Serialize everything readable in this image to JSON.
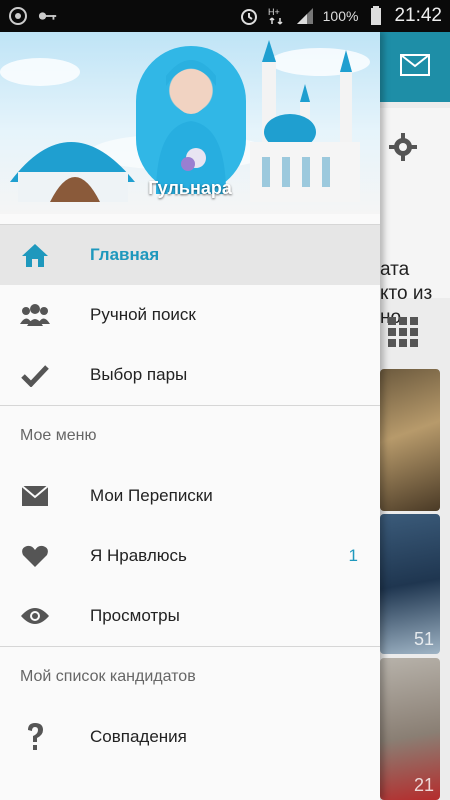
{
  "status_bar": {
    "battery_text": "100%",
    "time": "21:42"
  },
  "header": {
    "name": "Гульнара"
  },
  "menu": {
    "items": [
      {
        "label": "Главная",
        "icon": "home-icon",
        "active": true
      },
      {
        "label": "Ручной поиск",
        "icon": "users-icon"
      },
      {
        "label": "Выбор пары",
        "icon": "check-icon"
      }
    ],
    "section1_title": "Мое меню",
    "section1_items": [
      {
        "label": "Мои Переписки",
        "icon": "mail-icon"
      },
      {
        "label": "Я Нравлюсь",
        "icon": "heart-icon",
        "badge": "1"
      },
      {
        "label": "Просмотры",
        "icon": "eye-icon"
      }
    ],
    "section2_title": "Мой список кандидатов",
    "section2_items": [
      {
        "label": "Совпадения",
        "icon": "question-icon"
      }
    ]
  },
  "background": {
    "text_lines": "ата\nкто из\nно",
    "photo_counts": [
      "51",
      "21"
    ]
  },
  "colors": {
    "accent": "#1e98bd",
    "toolbar": "#1e8ea7"
  }
}
